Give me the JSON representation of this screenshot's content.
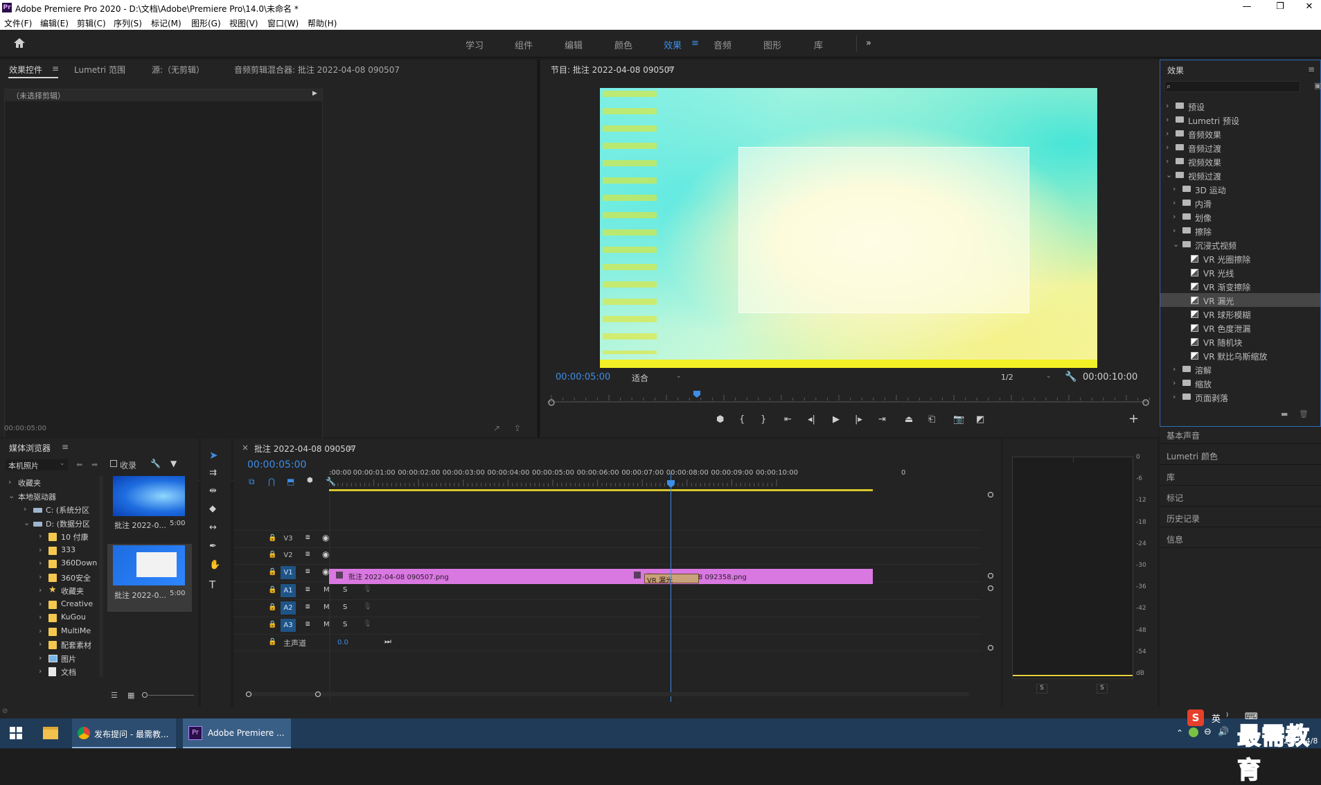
{
  "window": {
    "title": "Adobe Premiere Pro 2020 - D:\\文档\\Adobe\\Premiere Pro\\14.0\\未命名 *",
    "app_icon": "Pr"
  },
  "menu": [
    "文件(F)",
    "编辑(E)",
    "剪辑(C)",
    "序列(S)",
    "标记(M)",
    "图形(G)",
    "视图(V)",
    "窗口(W)",
    "帮助(H)"
  ],
  "workspaces": {
    "items": [
      "学习",
      "组件",
      "编辑",
      "颜色",
      "效果",
      "音频",
      "图形",
      "库"
    ],
    "active": "效果",
    "more": "»"
  },
  "source_panel": {
    "tabs": [
      "效果控件",
      "Lumetri 范围",
      "源:（无剪辑）",
      "音频剪辑混合器: 批注 2022-04-08 090507"
    ],
    "no_clip": "（未选择剪辑）",
    "timecode": "00:00:05:00"
  },
  "program": {
    "tab": "节目: 批注 2022-04-08 090507",
    "timecode": "00:00:05:00",
    "fit": "适合",
    "resolution": "1/2",
    "duration": "00:00:10:00"
  },
  "effects": {
    "tab": "效果",
    "search_placeholder": "",
    "top": [
      "预设",
      "Lumetri 预设",
      "音频效果",
      "音频过渡",
      "视频效果",
      "视频过渡"
    ],
    "video_transitions": [
      "3D 运动",
      "内滑",
      "划像",
      "擦除",
      "沉浸式视频"
    ],
    "immersive": [
      "VR 光圈擦除",
      "VR 光线",
      "VR 渐变擦除",
      "VR 漏光",
      "VR 球形模糊",
      "VR 色度泄漏",
      "VR 随机块",
      "VR 默比乌斯缩放"
    ],
    "selected": "VR 漏光",
    "more": [
      "溶解",
      "缩放",
      "页面剥落"
    ]
  },
  "side_panels": [
    "基本声音",
    "Lumetri 颜色",
    "库",
    "标记",
    "历史记录",
    "信息"
  ],
  "media_browser": {
    "tab": "媒体浏览器",
    "source_select": "本机照片",
    "favorites_checkbox": "收录",
    "tree": [
      {
        "label": "收藏夹",
        "level": 0,
        "icon": "none",
        "chev": "›"
      },
      {
        "label": "本地驱动器",
        "level": 0,
        "icon": "none",
        "chev": "⌄"
      },
      {
        "label": "C: (系统分区",
        "level": 1,
        "icon": "drive",
        "chev": "›"
      },
      {
        "label": "D: (数据分区",
        "level": 1,
        "icon": "drive",
        "chev": "⌄"
      },
      {
        "label": "10 付康",
        "level": 2,
        "icon": "folder",
        "chev": "›"
      },
      {
        "label": "333",
        "level": 2,
        "icon": "folder",
        "chev": "›"
      },
      {
        "label": "360Down",
        "level": 2,
        "icon": "folder",
        "chev": "›"
      },
      {
        "label": "360安全",
        "level": 2,
        "icon": "folder",
        "chev": "›"
      },
      {
        "label": "收藏夹",
        "level": 2,
        "icon": "star",
        "chev": "›"
      },
      {
        "label": "Creative",
        "level": 2,
        "icon": "folder",
        "chev": "›"
      },
      {
        "label": "KuGou",
        "level": 2,
        "icon": "folder",
        "chev": "›"
      },
      {
        "label": "MultiMe",
        "level": 2,
        "icon": "folder",
        "chev": "›"
      },
      {
        "label": "配套素材",
        "level": 2,
        "icon": "folder",
        "chev": "›"
      },
      {
        "label": "图片",
        "level": 2,
        "icon": "pictures",
        "chev": "›"
      },
      {
        "label": "文档",
        "level": 2,
        "icon": "docs",
        "chev": "›"
      }
    ],
    "thumbs": [
      {
        "name": "批注 2022-0...",
        "dur": "5:00"
      },
      {
        "name": "批注 2022-0...",
        "dur": "5:00"
      }
    ]
  },
  "timeline": {
    "tab": "批注 2022-04-08 090507",
    "timecode": "00:00:05:00",
    "ruler": [
      ":00:00",
      "00:00:01:00",
      "00:00:02:00",
      "00:00:03:00",
      "00:00:04:00",
      "00:00:05:00",
      "00:00:06:00",
      "00:00:07:00",
      "00:00:08:00",
      "00:00:09:00",
      "00:00:10:00",
      "0"
    ],
    "video_tracks": [
      "V3",
      "V2",
      "V1"
    ],
    "audio_tracks": [
      "A1",
      "A2",
      "A3"
    ],
    "master": "主声道",
    "master_value": "0.0",
    "mute": "M",
    "solo": "S",
    "clip1": "批注 2022-04-08 090507.png",
    "clip2": "批注 2022-04-08 092358.png",
    "transition": "VR 漏光"
  },
  "meter": {
    "scale": [
      "0",
      "-6",
      "-12",
      "-18",
      "-24",
      "-30",
      "-36",
      "-42",
      "-48",
      "-54",
      "dB"
    ],
    "solo": [
      "S",
      "S"
    ]
  },
  "taskbar": {
    "apps": [
      "发布提问 - 最需教...",
      "Adobe Premiere ..."
    ],
    "ime": "英",
    "watermark": "最需教育",
    "date": "2022/4/8"
  },
  "colors": {
    "accent": "#3d8ee6",
    "clip": "#d978e0",
    "track_blue": "#1f5486",
    "transition": "#c9a27a"
  }
}
